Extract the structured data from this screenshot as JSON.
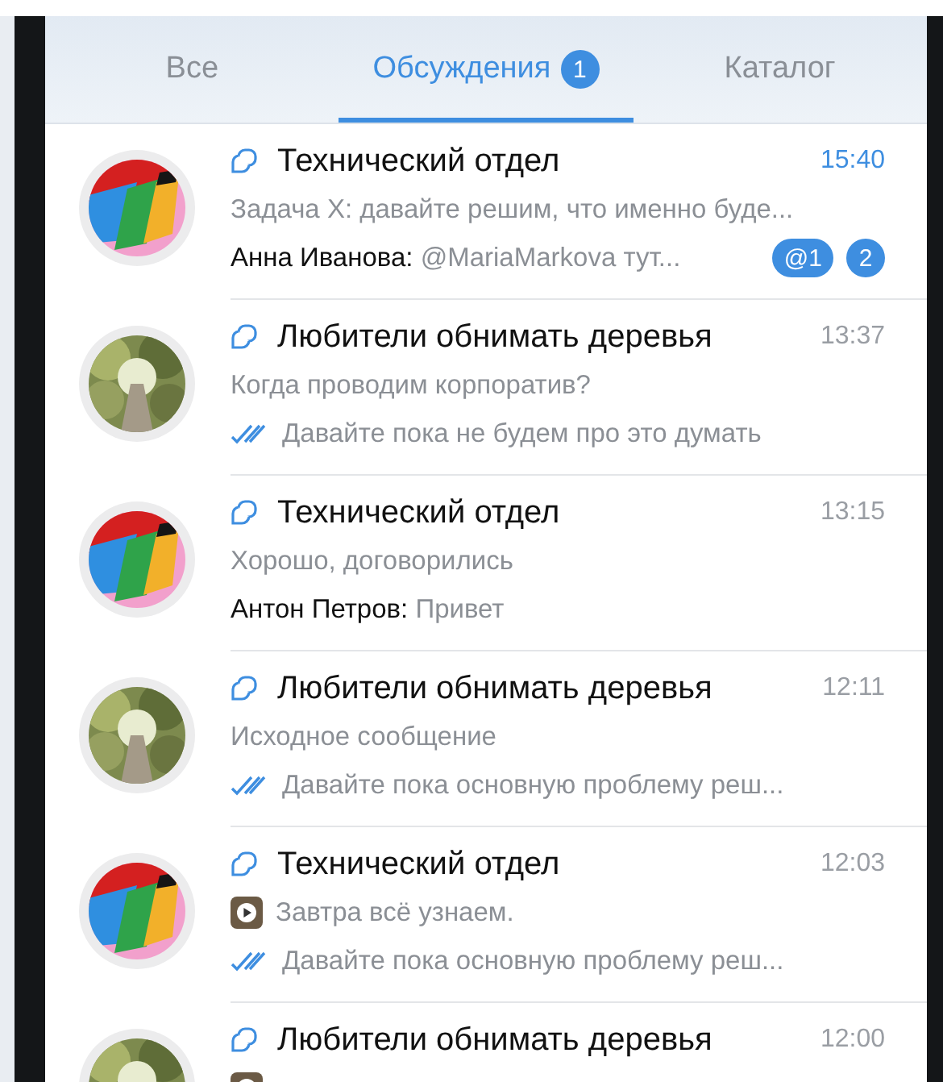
{
  "tabs": [
    {
      "label": "Все",
      "selected": false
    },
    {
      "label": "Обсуждения",
      "selected": true,
      "badge": "1"
    },
    {
      "label": "Каталог",
      "selected": false
    }
  ],
  "chats": [
    {
      "title": "Технический отдел",
      "time": "15:40",
      "unread": true,
      "line2": {
        "media": false,
        "text": "Задача X: давайте решим, что именно буде..."
      },
      "line3": {
        "kind": "sender",
        "sender": "Анна Иванова:",
        "text": "@MariaMarkova тут..."
      },
      "badges": [
        "@1",
        "2"
      ]
    },
    {
      "title": "Любители обнимать деревья",
      "time": "13:37",
      "unread": false,
      "line2": {
        "media": false,
        "text": "Когда проводим корпоратив?"
      },
      "line3": {
        "kind": "sent",
        "text": "Давайте пока не будем про это думать"
      }
    },
    {
      "title": "Технический отдел",
      "time": "13:15",
      "unread": false,
      "line2": {
        "media": false,
        "text": "Хорошо, договорились"
      },
      "line3": {
        "kind": "sender",
        "sender": "Антон Петров:",
        "text": "Привет"
      }
    },
    {
      "title": "Любители обнимать деревья",
      "time": "12:11",
      "unread": false,
      "line2": {
        "media": false,
        "text": "Исходное сообщение"
      },
      "line3": {
        "kind": "sent",
        "text": "Давайте пока основную проблему реш..."
      }
    },
    {
      "title": "Технический отдел",
      "time": "12:03",
      "unread": false,
      "line2": {
        "media": true,
        "text": "Завтра всё узнаем."
      },
      "line3": {
        "kind": "sent",
        "text": "Давайте пока основную проблему реш..."
      }
    },
    {
      "title": "Любители обнимать деревья",
      "time": "12:00",
      "unread": false,
      "line2": {
        "media": true
      }
    }
  ]
}
